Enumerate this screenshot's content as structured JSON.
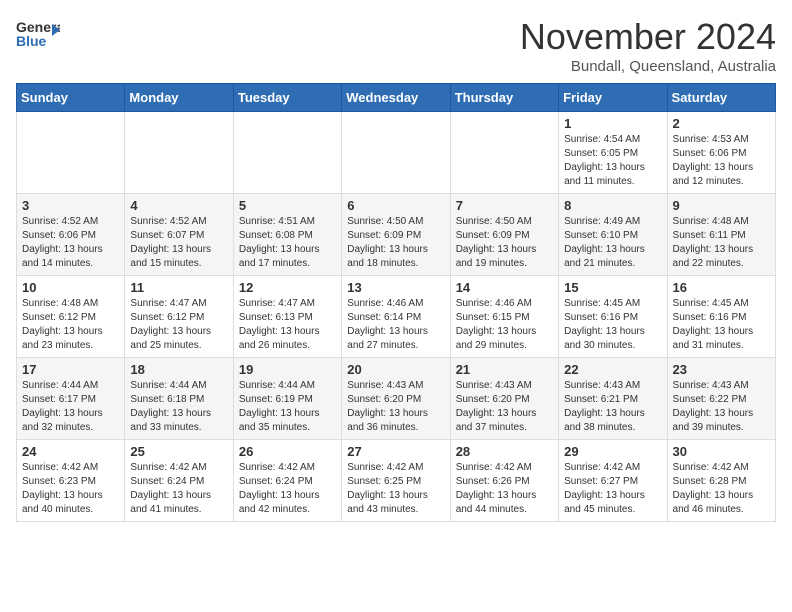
{
  "header": {
    "logo_general": "General",
    "logo_blue": "Blue",
    "month": "November 2024",
    "location": "Bundall, Queensland, Australia"
  },
  "weekdays": [
    "Sunday",
    "Monday",
    "Tuesday",
    "Wednesday",
    "Thursday",
    "Friday",
    "Saturday"
  ],
  "rows": [
    [
      {
        "day": "",
        "sunrise": "",
        "sunset": "",
        "daylight": ""
      },
      {
        "day": "",
        "sunrise": "",
        "sunset": "",
        "daylight": ""
      },
      {
        "day": "",
        "sunrise": "",
        "sunset": "",
        "daylight": ""
      },
      {
        "day": "",
        "sunrise": "",
        "sunset": "",
        "daylight": ""
      },
      {
        "day": "",
        "sunrise": "",
        "sunset": "",
        "daylight": ""
      },
      {
        "day": "1",
        "sunrise": "Sunrise: 4:54 AM",
        "sunset": "Sunset: 6:05 PM",
        "daylight": "Daylight: 13 hours and 11 minutes."
      },
      {
        "day": "2",
        "sunrise": "Sunrise: 4:53 AM",
        "sunset": "Sunset: 6:06 PM",
        "daylight": "Daylight: 13 hours and 12 minutes."
      }
    ],
    [
      {
        "day": "3",
        "sunrise": "Sunrise: 4:52 AM",
        "sunset": "Sunset: 6:06 PM",
        "daylight": "Daylight: 13 hours and 14 minutes."
      },
      {
        "day": "4",
        "sunrise": "Sunrise: 4:52 AM",
        "sunset": "Sunset: 6:07 PM",
        "daylight": "Daylight: 13 hours and 15 minutes."
      },
      {
        "day": "5",
        "sunrise": "Sunrise: 4:51 AM",
        "sunset": "Sunset: 6:08 PM",
        "daylight": "Daylight: 13 hours and 17 minutes."
      },
      {
        "day": "6",
        "sunrise": "Sunrise: 4:50 AM",
        "sunset": "Sunset: 6:09 PM",
        "daylight": "Daylight: 13 hours and 18 minutes."
      },
      {
        "day": "7",
        "sunrise": "Sunrise: 4:50 AM",
        "sunset": "Sunset: 6:09 PM",
        "daylight": "Daylight: 13 hours and 19 minutes."
      },
      {
        "day": "8",
        "sunrise": "Sunrise: 4:49 AM",
        "sunset": "Sunset: 6:10 PM",
        "daylight": "Daylight: 13 hours and 21 minutes."
      },
      {
        "day": "9",
        "sunrise": "Sunrise: 4:48 AM",
        "sunset": "Sunset: 6:11 PM",
        "daylight": "Daylight: 13 hours and 22 minutes."
      }
    ],
    [
      {
        "day": "10",
        "sunrise": "Sunrise: 4:48 AM",
        "sunset": "Sunset: 6:12 PM",
        "daylight": "Daylight: 13 hours and 23 minutes."
      },
      {
        "day": "11",
        "sunrise": "Sunrise: 4:47 AM",
        "sunset": "Sunset: 6:12 PM",
        "daylight": "Daylight: 13 hours and 25 minutes."
      },
      {
        "day": "12",
        "sunrise": "Sunrise: 4:47 AM",
        "sunset": "Sunset: 6:13 PM",
        "daylight": "Daylight: 13 hours and 26 minutes."
      },
      {
        "day": "13",
        "sunrise": "Sunrise: 4:46 AM",
        "sunset": "Sunset: 6:14 PM",
        "daylight": "Daylight: 13 hours and 27 minutes."
      },
      {
        "day": "14",
        "sunrise": "Sunrise: 4:46 AM",
        "sunset": "Sunset: 6:15 PM",
        "daylight": "Daylight: 13 hours and 29 minutes."
      },
      {
        "day": "15",
        "sunrise": "Sunrise: 4:45 AM",
        "sunset": "Sunset: 6:16 PM",
        "daylight": "Daylight: 13 hours and 30 minutes."
      },
      {
        "day": "16",
        "sunrise": "Sunrise: 4:45 AM",
        "sunset": "Sunset: 6:16 PM",
        "daylight": "Daylight: 13 hours and 31 minutes."
      }
    ],
    [
      {
        "day": "17",
        "sunrise": "Sunrise: 4:44 AM",
        "sunset": "Sunset: 6:17 PM",
        "daylight": "Daylight: 13 hours and 32 minutes."
      },
      {
        "day": "18",
        "sunrise": "Sunrise: 4:44 AM",
        "sunset": "Sunset: 6:18 PM",
        "daylight": "Daylight: 13 hours and 33 minutes."
      },
      {
        "day": "19",
        "sunrise": "Sunrise: 4:44 AM",
        "sunset": "Sunset: 6:19 PM",
        "daylight": "Daylight: 13 hours and 35 minutes."
      },
      {
        "day": "20",
        "sunrise": "Sunrise: 4:43 AM",
        "sunset": "Sunset: 6:20 PM",
        "daylight": "Daylight: 13 hours and 36 minutes."
      },
      {
        "day": "21",
        "sunrise": "Sunrise: 4:43 AM",
        "sunset": "Sunset: 6:20 PM",
        "daylight": "Daylight: 13 hours and 37 minutes."
      },
      {
        "day": "22",
        "sunrise": "Sunrise: 4:43 AM",
        "sunset": "Sunset: 6:21 PM",
        "daylight": "Daylight: 13 hours and 38 minutes."
      },
      {
        "day": "23",
        "sunrise": "Sunrise: 4:43 AM",
        "sunset": "Sunset: 6:22 PM",
        "daylight": "Daylight: 13 hours and 39 minutes."
      }
    ],
    [
      {
        "day": "24",
        "sunrise": "Sunrise: 4:42 AM",
        "sunset": "Sunset: 6:23 PM",
        "daylight": "Daylight: 13 hours and 40 minutes."
      },
      {
        "day": "25",
        "sunrise": "Sunrise: 4:42 AM",
        "sunset": "Sunset: 6:24 PM",
        "daylight": "Daylight: 13 hours and 41 minutes."
      },
      {
        "day": "26",
        "sunrise": "Sunrise: 4:42 AM",
        "sunset": "Sunset: 6:24 PM",
        "daylight": "Daylight: 13 hours and 42 minutes."
      },
      {
        "day": "27",
        "sunrise": "Sunrise: 4:42 AM",
        "sunset": "Sunset: 6:25 PM",
        "daylight": "Daylight: 13 hours and 43 minutes."
      },
      {
        "day": "28",
        "sunrise": "Sunrise: 4:42 AM",
        "sunset": "Sunset: 6:26 PM",
        "daylight": "Daylight: 13 hours and 44 minutes."
      },
      {
        "day": "29",
        "sunrise": "Sunrise: 4:42 AM",
        "sunset": "Sunset: 6:27 PM",
        "daylight": "Daylight: 13 hours and 45 minutes."
      },
      {
        "day": "30",
        "sunrise": "Sunrise: 4:42 AM",
        "sunset": "Sunset: 6:28 PM",
        "daylight": "Daylight: 13 hours and 46 minutes."
      }
    ]
  ]
}
